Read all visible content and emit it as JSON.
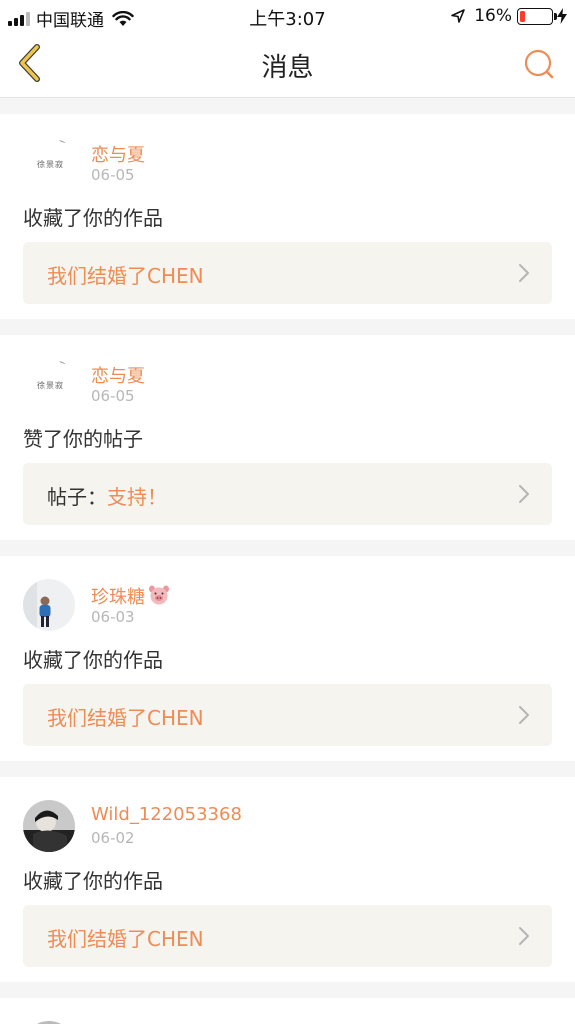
{
  "status_bar": {
    "carrier": "中国联通",
    "time": "上午3:07",
    "battery_percent": "16%",
    "battery_level": 0.16,
    "icons": [
      "signal-icon",
      "wifi-icon",
      "location-arrow-icon",
      "battery-icon",
      "charging-bolt-icon"
    ]
  },
  "nav": {
    "title": "消息",
    "back_icon": "chevron-left-icon",
    "search_icon": "search-icon"
  },
  "colors": {
    "accent": "#ee8c56",
    "back_arrow": "#f0c64a",
    "link_bg": "#f5f4ee",
    "date": "#b7b7b7"
  },
  "messages": [
    {
      "username": "恋与夏",
      "date": "06-05",
      "action": "收藏了你的作品",
      "link_prefix": "",
      "link_text": "我们结婚了CHEN",
      "avatar": "logo-avatar",
      "avatar_text": "徐景寂"
    },
    {
      "username": "恋与夏",
      "date": "06-05",
      "action": "赞了你的帖子",
      "link_prefix": "帖子：",
      "link_text": "支持！",
      "avatar": "logo-avatar",
      "avatar_text": "徐景寂"
    },
    {
      "username": "珍珠糖",
      "username_emoji": "pig-face-icon",
      "date": "06-03",
      "action": "收藏了你的作品",
      "link_prefix": "",
      "link_text": "我们结婚了CHEN",
      "avatar": "photo-avatar"
    },
    {
      "username": "Wild_122053368",
      "date": "06-02",
      "action": "收藏了你的作品",
      "link_prefix": "",
      "link_text": "我们结婚了CHEN",
      "avatar": "photo-avatar"
    }
  ]
}
